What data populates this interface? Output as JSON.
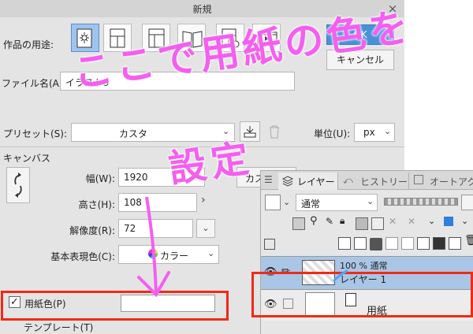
{
  "dialog": {
    "title": "新規",
    "close_icon": "×",
    "usage_label": "作品の用途:",
    "ok_label": "OK",
    "cancel_label": "キャンセル",
    "filename_label": "ファイル名(A):",
    "filename_value": "イラスト3",
    "preset_label": "プリセット(S):",
    "preset_value": "カスタ",
    "unit_label": "単位(U):",
    "unit_value": "px",
    "canvas_section": "キャンバス",
    "width_label": "幅(W):",
    "width_value": "1920",
    "height_label": "高さ(H):",
    "height_value": "108",
    "custom_button": "カス",
    "resolution_label": "解像度(R):",
    "resolution_value": "72",
    "color_mode_label": "基本表現色(C):",
    "color_mode_value": "カラー",
    "paper_color_label": "用紙色(P)",
    "paper_color_checked": true,
    "template_label": "テンプレート(T)",
    "accent_color": "#4a90d9"
  },
  "layer_panel": {
    "tabs": [
      "レイヤー",
      "ヒストリー",
      "オートアクシ"
    ],
    "blend_mode": "通常",
    "layers": [
      {
        "name": "100 % 通常",
        "sub": "レイヤー 1",
        "selected": true
      },
      {
        "name": "用紙",
        "sub": "",
        "selected": false
      }
    ]
  },
  "annotation": {
    "line1": "ここで用紙の色を",
    "line2": "設定",
    "color": "#f45ff0",
    "highlight_color": "#f02a14"
  }
}
